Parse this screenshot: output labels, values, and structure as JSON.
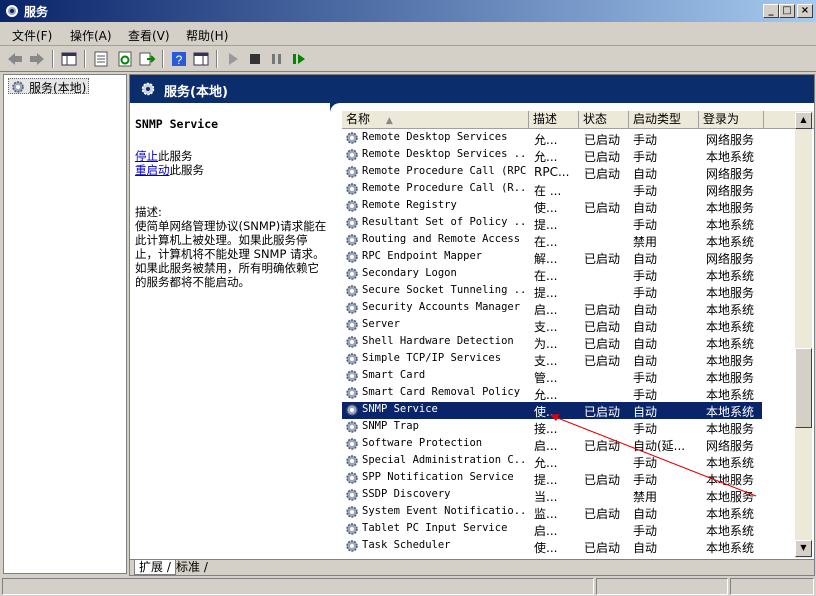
{
  "window": {
    "title": "服务"
  },
  "menu": [
    "文件(F)",
    "操作(A)",
    "查看(V)",
    "帮助(H)"
  ],
  "tree": {
    "item": "服务(本地)"
  },
  "header": {
    "title": "服务(本地)"
  },
  "desc_pane": {
    "service_name": "SNMP Service",
    "stop_link": "停止",
    "stop_suffix": "此服务",
    "restart_link": "重启动",
    "restart_suffix": "此服务",
    "desc_label": "描述:",
    "desc_text": "使简单网络管理协议(SNMP)请求能在此计算机上被处理。如果此服务停止，计算机将不能处理 SNMP 请求。如果此服务被禁用，所有明确依赖它的服务都将不能启动。"
  },
  "columns": [
    "名称",
    "描述",
    "状态",
    "启动类型",
    "登录为"
  ],
  "rows": [
    [
      "Remote Desktop Services",
      "允...",
      "已启动",
      "手动",
      "网络服务"
    ],
    [
      "Remote Desktop Services ...",
      "允...",
      "已启动",
      "手动",
      "本地系统"
    ],
    [
      "Remote Procedure Call (RPC)",
      "RPC...",
      "已启动",
      "自动",
      "网络服务"
    ],
    [
      "Remote Procedure Call (R...",
      "在 ...",
      "",
      "手动",
      "网络服务"
    ],
    [
      "Remote Registry",
      "使...",
      "已启动",
      "自动",
      "本地服务"
    ],
    [
      "Resultant Set of Policy ...",
      "提...",
      "",
      "手动",
      "本地系统"
    ],
    [
      "Routing and Remote Access",
      "在...",
      "",
      "禁用",
      "本地系统"
    ],
    [
      "RPC Endpoint Mapper",
      "解...",
      "已启动",
      "自动",
      "网络服务"
    ],
    [
      "Secondary Logon",
      "在...",
      "",
      "手动",
      "本地系统"
    ],
    [
      "Secure Socket Tunneling ...",
      "提...",
      "",
      "手动",
      "本地服务"
    ],
    [
      "Security Accounts Manager",
      "启...",
      "已启动",
      "自动",
      "本地系统"
    ],
    [
      "Server",
      "支...",
      "已启动",
      "自动",
      "本地系统"
    ],
    [
      "Shell Hardware Detection",
      "为...",
      "已启动",
      "自动",
      "本地系统"
    ],
    [
      "Simple TCP/IP Services",
      "支...",
      "已启动",
      "自动",
      "本地服务"
    ],
    [
      "Smart Card",
      "管...",
      "",
      "手动",
      "本地服务"
    ],
    [
      "Smart Card Removal Policy",
      "允...",
      "",
      "手动",
      "本地系统"
    ],
    [
      "SNMP Service",
      "使...",
      "已启动",
      "自动",
      "本地系统"
    ],
    [
      "SNMP Trap",
      "接...",
      "",
      "手动",
      "本地服务"
    ],
    [
      "Software Protection",
      "启...",
      "已启动",
      "自动(延...",
      "网络服务"
    ],
    [
      "Special Administration C...",
      "允...",
      "",
      "手动",
      "本地系统"
    ],
    [
      "SPP Notification Service",
      "提...",
      "已启动",
      "手动",
      "本地服务"
    ],
    [
      "SSDP Discovery",
      "当...",
      "",
      "禁用",
      "本地服务"
    ],
    [
      "System Event Notificatio...",
      "监...",
      "已启动",
      "自动",
      "本地系统"
    ],
    [
      "Tablet PC Input Service",
      "启...",
      "",
      "手动",
      "本地系统"
    ],
    [
      "Task Scheduler",
      "使...",
      "已启动",
      "自动",
      "本地系统"
    ]
  ],
  "selected_row": 16,
  "tabs": [
    "扩展",
    "标准"
  ],
  "colors": {
    "header_band": "#0c2d6b",
    "selection": "#0a246a",
    "annotation_arrow": "#e00000"
  }
}
